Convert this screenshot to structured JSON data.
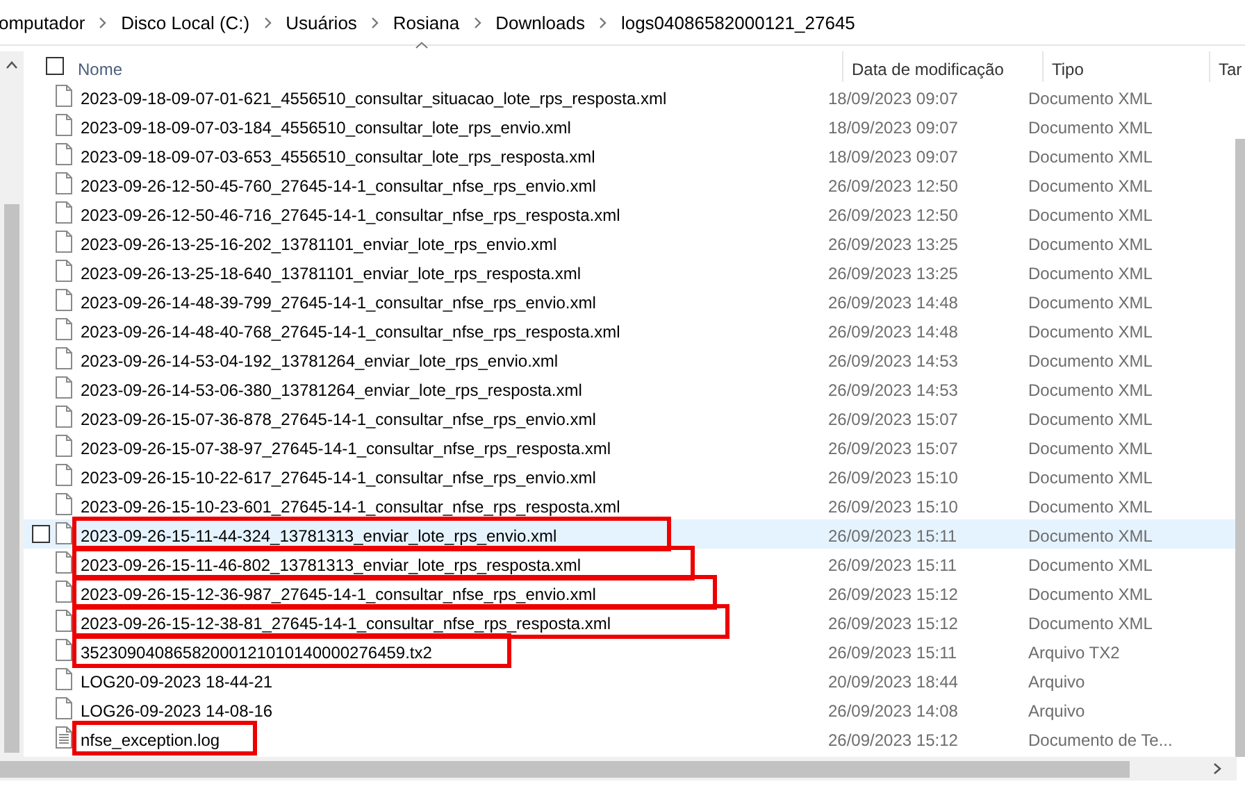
{
  "breadcrumb": [
    "omputador",
    "Disco Local (C:)",
    "Usuários",
    "Rosiana",
    "Downloads",
    "logs04086582000121_27645"
  ],
  "select_all": {
    "checked": false
  },
  "columns": [
    {
      "label": "Nome",
      "sorted": true
    },
    {
      "label": "Data de modificação",
      "sorted": false
    },
    {
      "label": "Tipo",
      "sorted": false
    },
    {
      "label": "Tar",
      "sorted": false
    }
  ],
  "rows": [
    {
      "name": "2023-09-18-09-07-01-621_4556510_consultar_situacao_lote_rps_resposta.xml",
      "date": "18/09/2023 09:07",
      "type": "Documento XML",
      "kind": "file",
      "hovered": false,
      "highlighted": false
    },
    {
      "name": "2023-09-18-09-07-03-184_4556510_consultar_lote_rps_envio.xml",
      "date": "18/09/2023 09:07",
      "type": "Documento XML",
      "kind": "file",
      "hovered": false,
      "highlighted": false
    },
    {
      "name": "2023-09-18-09-07-03-653_4556510_consultar_lote_rps_resposta.xml",
      "date": "18/09/2023 09:07",
      "type": "Documento XML",
      "kind": "file",
      "hovered": false,
      "highlighted": false
    },
    {
      "name": "2023-09-26-12-50-45-760_27645-14-1_consultar_nfse_rps_envio.xml",
      "date": "26/09/2023 12:50",
      "type": "Documento XML",
      "kind": "file",
      "hovered": false,
      "highlighted": false
    },
    {
      "name": "2023-09-26-12-50-46-716_27645-14-1_consultar_nfse_rps_resposta.xml",
      "date": "26/09/2023 12:50",
      "type": "Documento XML",
      "kind": "file",
      "hovered": false,
      "highlighted": false
    },
    {
      "name": "2023-09-26-13-25-16-202_13781101_enviar_lote_rps_envio.xml",
      "date": "26/09/2023 13:25",
      "type": "Documento XML",
      "kind": "file",
      "hovered": false,
      "highlighted": false
    },
    {
      "name": "2023-09-26-13-25-18-640_13781101_enviar_lote_rps_resposta.xml",
      "date": "26/09/2023 13:25",
      "type": "Documento XML",
      "kind": "file",
      "hovered": false,
      "highlighted": false
    },
    {
      "name": "2023-09-26-14-48-39-799_27645-14-1_consultar_nfse_rps_envio.xml",
      "date": "26/09/2023 14:48",
      "type": "Documento XML",
      "kind": "file",
      "hovered": false,
      "highlighted": false
    },
    {
      "name": "2023-09-26-14-48-40-768_27645-14-1_consultar_nfse_rps_resposta.xml",
      "date": "26/09/2023 14:48",
      "type": "Documento XML",
      "kind": "file",
      "hovered": false,
      "highlighted": false
    },
    {
      "name": "2023-09-26-14-53-04-192_13781264_enviar_lote_rps_envio.xml",
      "date": "26/09/2023 14:53",
      "type": "Documento XML",
      "kind": "file",
      "hovered": false,
      "highlighted": false
    },
    {
      "name": "2023-09-26-14-53-06-380_13781264_enviar_lote_rps_resposta.xml",
      "date": "26/09/2023 14:53",
      "type": "Documento XML",
      "kind": "file",
      "hovered": false,
      "highlighted": false
    },
    {
      "name": "2023-09-26-15-07-36-878_27645-14-1_consultar_nfse_rps_envio.xml",
      "date": "26/09/2023 15:07",
      "type": "Documento XML",
      "kind": "file",
      "hovered": false,
      "highlighted": false
    },
    {
      "name": "2023-09-26-15-07-38-97_27645-14-1_consultar_nfse_rps_resposta.xml",
      "date": "26/09/2023 15:07",
      "type": "Documento XML",
      "kind": "file",
      "hovered": false,
      "highlighted": false
    },
    {
      "name": "2023-09-26-15-10-22-617_27645-14-1_consultar_nfse_rps_envio.xml",
      "date": "26/09/2023 15:10",
      "type": "Documento XML",
      "kind": "file",
      "hovered": false,
      "highlighted": false
    },
    {
      "name": "2023-09-26-15-10-23-601_27645-14-1_consultar_nfse_rps_resposta.xml",
      "date": "26/09/2023 15:10",
      "type": "Documento XML",
      "kind": "file",
      "hovered": false,
      "highlighted": false
    },
    {
      "name": "2023-09-26-15-11-44-324_13781313_enviar_lote_rps_envio.xml",
      "date": "26/09/2023 15:11",
      "type": "Documento XML",
      "kind": "file",
      "hovered": true,
      "highlighted": true
    },
    {
      "name": "2023-09-26-15-11-46-802_13781313_enviar_lote_rps_resposta.xml",
      "date": "26/09/2023 15:11",
      "type": "Documento XML",
      "kind": "file",
      "hovered": false,
      "highlighted": true
    },
    {
      "name": "2023-09-26-15-12-36-987_27645-14-1_consultar_nfse_rps_envio.xml",
      "date": "26/09/2023 15:12",
      "type": "Documento XML",
      "kind": "file",
      "hovered": false,
      "highlighted": true
    },
    {
      "name": "2023-09-26-15-12-38-81_27645-14-1_consultar_nfse_rps_resposta.xml",
      "date": "26/09/2023 15:12",
      "type": "Documento XML",
      "kind": "file",
      "hovered": false,
      "highlighted": true
    },
    {
      "name": "35230904086582000121010140000276459.tx2",
      "date": "26/09/2023 15:11",
      "type": "Arquivo TX2",
      "kind": "file",
      "hovered": false,
      "highlighted": true
    },
    {
      "name": "LOG20-09-2023 18-44-21",
      "date": "20/09/2023 18:44",
      "type": "Arquivo",
      "kind": "file",
      "hovered": false,
      "highlighted": false
    },
    {
      "name": "LOG26-09-2023 14-08-16",
      "date": "26/09/2023 14:08",
      "type": "Arquivo",
      "kind": "file",
      "hovered": false,
      "highlighted": false
    },
    {
      "name": "nfse_exception.log",
      "date": "26/09/2023 15:12",
      "type": "Documento de Te...",
      "kind": "text_file",
      "hovered": false,
      "highlighted": true
    }
  ]
}
